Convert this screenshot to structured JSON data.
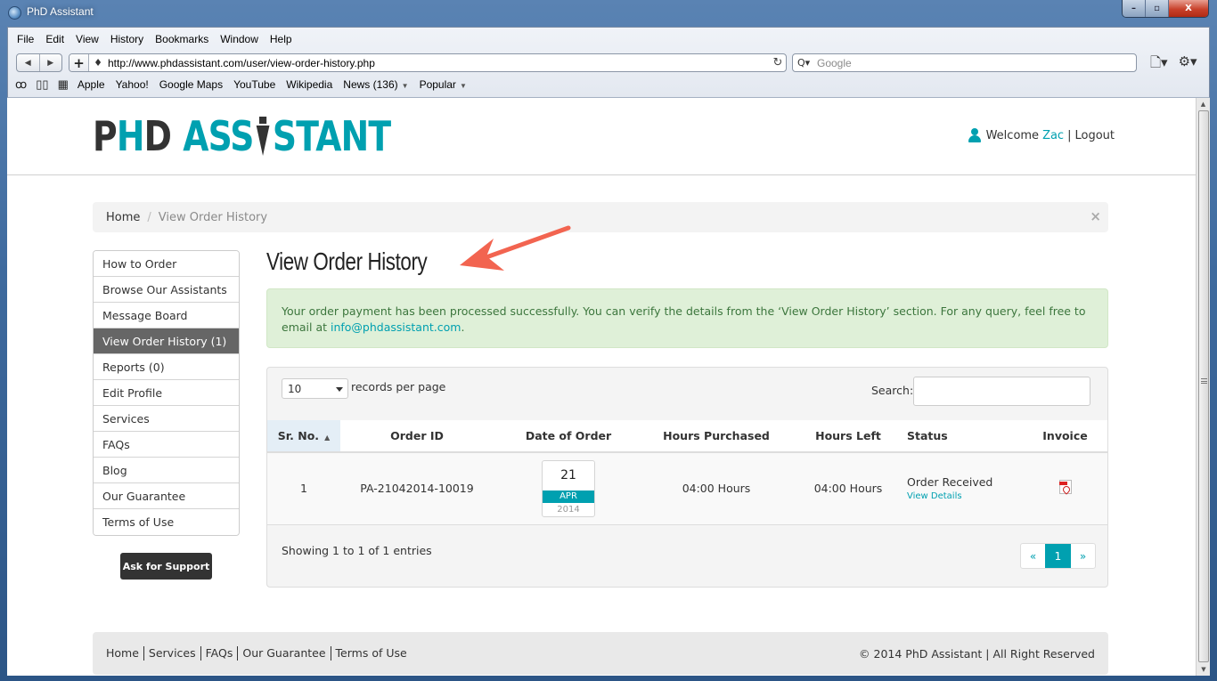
{
  "window": {
    "title": "PhD Assistant",
    "controls": {
      "minimize": "–",
      "maximize": "▫",
      "close": "X"
    }
  },
  "browser": {
    "menu": [
      "File",
      "Edit",
      "View",
      "History",
      "Bookmarks",
      "Window",
      "Help"
    ],
    "back": "◀",
    "forward": "▶",
    "add": "+",
    "url": "http://www.phdassistant.com/user/view-order-history.php",
    "reload": "↻",
    "search_placeholder": "Google",
    "search_icon": "Q▾",
    "page_menu": "🗋▾",
    "settings_menu": "⚙▾",
    "bookmarks": [
      {
        "label": "Apple"
      },
      {
        "label": "Yahoo!"
      },
      {
        "label": "Google Maps"
      },
      {
        "label": "YouTube"
      },
      {
        "label": "Wikipedia"
      },
      {
        "label": "News (136)",
        "dropdown": true
      },
      {
        "label": "Popular",
        "dropdown": true
      }
    ],
    "bm_icons": {
      "reading_list": "👓",
      "bookmarks": "📖",
      "top_sites": "▦"
    }
  },
  "site": {
    "logo": {
      "part1a": "P",
      "part1b": "H",
      "part1c": "D",
      "part2a": "ASS",
      "part2b": "STANT"
    },
    "user": {
      "welcome": "Welcome",
      "name": "Zac",
      "separator": "|",
      "logout": "Logout"
    },
    "breadcrumb": {
      "home": "Home",
      "divider": "/",
      "current": "View Order History",
      "close": "×"
    },
    "sidebar": [
      {
        "label": "How to Order",
        "active": false
      },
      {
        "label": "Browse Our Assistants",
        "active": false
      },
      {
        "label": "Message Board",
        "active": false
      },
      {
        "label": "View Order History (1)",
        "active": true
      },
      {
        "label": "Reports (0)",
        "active": false
      },
      {
        "label": "Edit Profile",
        "active": false
      },
      {
        "label": "Services",
        "active": false
      },
      {
        "label": "FAQs",
        "active": false
      },
      {
        "label": "Blog",
        "active": false
      },
      {
        "label": "Our Guarantee",
        "active": false
      },
      {
        "label": "Terms of Use",
        "active": false
      }
    ],
    "support_button": "Ask for Support",
    "page_title": "View Order History",
    "alert": {
      "text": "Your order payment has been processed successfully. You can verify the details from the ‘View Order History’ section. For any query, feel free to email at ",
      "email": "info@phdassistant.com",
      "suffix": "."
    },
    "table": {
      "length_value": "10",
      "length_label": "records per page",
      "search_label": "Search:",
      "search_value": "",
      "columns": [
        "Sr. No.",
        "Order ID",
        "Date of Order",
        "Hours Purchased",
        "Hours Left",
        "Status",
        "Invoice"
      ],
      "sort_indicator": "▲",
      "rows": [
        {
          "sr": "1",
          "order_id": "PA-21042014-10019",
          "date": {
            "day": "21",
            "month": "APR",
            "year": "2014"
          },
          "hours_purchased": "04:00 Hours",
          "hours_left": "04:00 Hours",
          "status": "Order Received",
          "details_link": "View Details",
          "invoice_icon": "pdf-icon"
        }
      ],
      "info": "Showing 1 to 1 of 1 entries",
      "pager": {
        "prev": "«",
        "current": "1",
        "next": "»"
      }
    },
    "footer": {
      "links": [
        "Home",
        "Services",
        "FAQs",
        "Our Guarantee",
        "Terms of Use"
      ],
      "copyright": "© 2014 PhD Assistant | All Right Reserved"
    },
    "colors": {
      "accent": "#00a0b0",
      "dark": "#333333",
      "alert_bg": "#dff0d8",
      "alert_text": "#3c763d",
      "annotation_arrow": "#f26450"
    }
  }
}
